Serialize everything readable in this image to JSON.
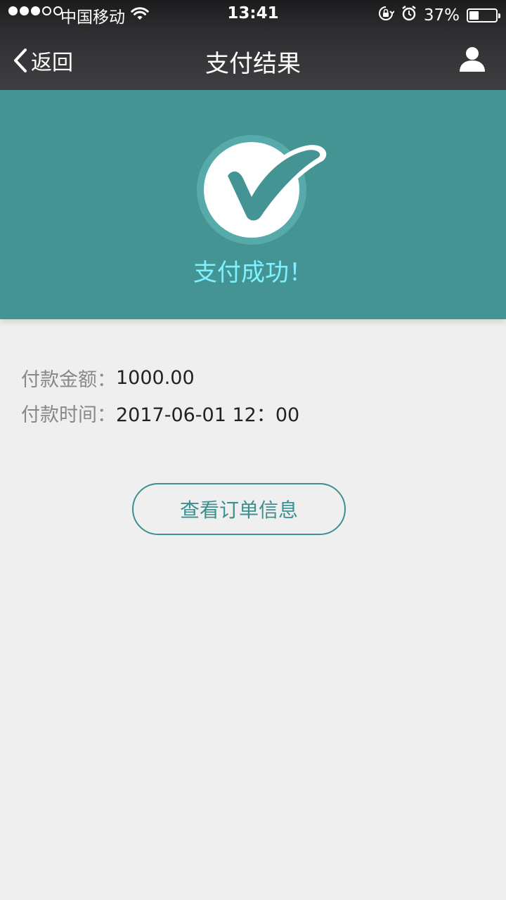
{
  "status_bar": {
    "carrier": "中国移动",
    "time": "13:41",
    "battery_percent": "37%",
    "battery_level": 0.37,
    "signal_bars_filled": 3,
    "signal_bars_total": 5
  },
  "nav": {
    "back_label": "返回",
    "title": "支付结果",
    "user_icon": "user-icon"
  },
  "banner": {
    "message": "支付成功！",
    "background_color": "#449494",
    "text_color": "#7ff2ff",
    "icon": "checkmark-icon"
  },
  "details": {
    "amount_label": "付款金额：",
    "amount_value": "1000.00",
    "time_label": "付款时间：",
    "time_value": "2017-06-01 12：00"
  },
  "actions": {
    "view_order_label": "查看订单信息",
    "accent_color": "#3c8f8f"
  }
}
